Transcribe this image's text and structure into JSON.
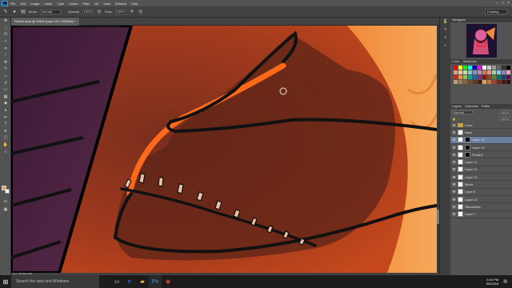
{
  "app": {
    "logo": "Ps"
  },
  "menu": [
    "File",
    "Edit",
    "Image",
    "Layer",
    "Type",
    "Select",
    "Filter",
    "3D",
    "View",
    "Window",
    "Help"
  ],
  "options": {
    "mode_label": "Mode:",
    "mode_value": "Normal",
    "opacity_label": "Opacity:",
    "opacity_value": "100%",
    "flow_label": "Flow:",
    "flow_value": "100%",
    "workspace": "Painting"
  },
  "document": {
    "tab_title": "PinkieLamb @ 296% (Layer 6C, RGB/8#) *",
    "status": "Doc: 28.0M/1.36G"
  },
  "panels": {
    "navigator_title": "Navigator",
    "swatches_tabs": [
      "Color",
      "Swatches"
    ],
    "layers_tabs": [
      "Layers",
      "Channels",
      "Paths"
    ],
    "blend_mode": "Normal",
    "opacity": "100%",
    "fill": "100%",
    "layers": [
      {
        "name": "Lines",
        "type": "folder"
      },
      {
        "name": "Base",
        "type": "layer"
      },
      {
        "name": "Layer 16",
        "type": "mask",
        "selected": true
      },
      {
        "name": "Layer 15",
        "type": "mask"
      },
      {
        "name": "Pinkie/2",
        "type": "mask"
      },
      {
        "name": "Layer 11",
        "type": "layer"
      },
      {
        "name": "Layer 12",
        "type": "layer"
      },
      {
        "name": "Layer 13",
        "type": "layer"
      },
      {
        "name": "Blush",
        "type": "layer"
      },
      {
        "name": "Layer 8",
        "type": "layer"
      },
      {
        "name": "Layer 10",
        "type": "layer"
      },
      {
        "name": "Silhouettes",
        "type": "layer"
      },
      {
        "name": "Layer 7",
        "type": "layer"
      }
    ]
  },
  "taskbar": {
    "search_placeholder": "Search the web and Windows",
    "time": "8:41 PM",
    "date": "6/6/2016"
  },
  "colors": {
    "foreground": "#e8a048",
    "background": "#ffffff",
    "ps_blue": "#31a8ff"
  }
}
